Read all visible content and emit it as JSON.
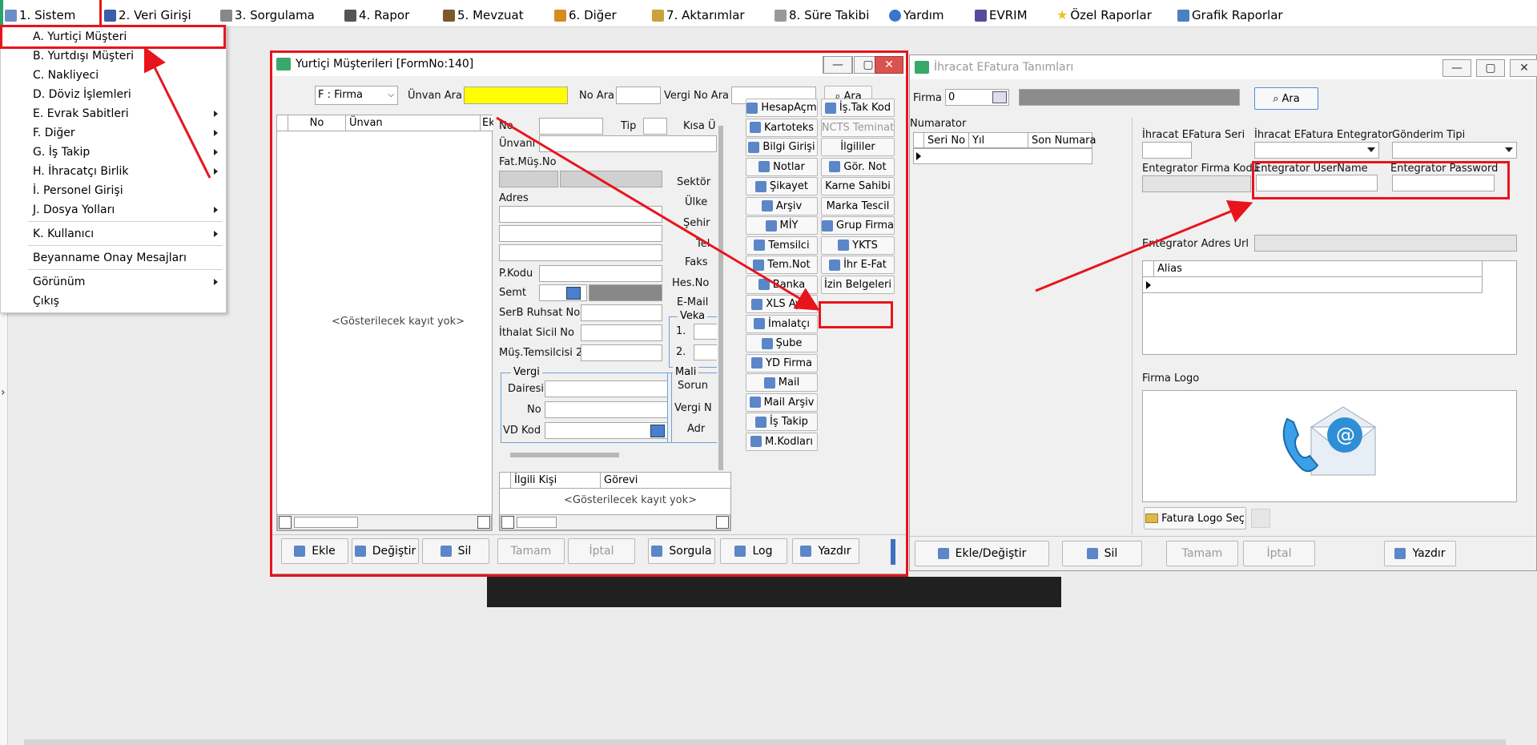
{
  "menu_bar": {
    "items": [
      {
        "label": "1.  Sistem",
        "icon": "system-icon"
      },
      {
        "label": "2.  Veri Girişi",
        "icon": "edit-icon"
      },
      {
        "label": "3.  Sorgulama",
        "icon": "query-icon"
      },
      {
        "label": "4.  Rapor",
        "icon": "printer-icon"
      },
      {
        "label": "5.  Mevzuat",
        "icon": "books-icon"
      },
      {
        "label": "6.  Diğer",
        "icon": "globe-icon"
      },
      {
        "label": "7.  Aktarımlar",
        "icon": "transfer-icon"
      },
      {
        "label": "8. Süre Takibi",
        "icon": "calendar-icon"
      },
      {
        "label": "Yardım",
        "icon": "help-icon"
      },
      {
        "label": "EVRIM",
        "icon": "book-icon"
      },
      {
        "label": "Özel Raporlar",
        "icon": "star-icon"
      },
      {
        "label": "Grafik Raporlar",
        "icon": "chart-icon"
      }
    ]
  },
  "sistem_menu": {
    "items": [
      {
        "label": "A.  Yurtiçi Müşteri",
        "has_submenu": false
      },
      {
        "label": "B.  Yurtdışı Müşteri",
        "has_submenu": false
      },
      {
        "label": "C.  Nakliyeci",
        "has_submenu": false
      },
      {
        "label": "D.  Döviz İşlemleri",
        "has_submenu": false
      },
      {
        "label": "E.  Evrak Sabitleri",
        "has_submenu": true
      },
      {
        "label": "F.  Diğer",
        "has_submenu": true
      },
      {
        "label": "G.  İş Takip",
        "has_submenu": true
      },
      {
        "label": "H.  İhracatçı Birlik",
        "has_submenu": true
      },
      {
        "label": "İ.   Personel Girişi",
        "has_submenu": false
      },
      {
        "label": "J.  Dosya Yolları",
        "has_submenu": true
      },
      {
        "label": "K.  Kullanıcı",
        "has_submenu": true
      },
      {
        "label": "Beyanname Onay Mesajları",
        "has_submenu": false
      },
      {
        "label": "Görünüm",
        "has_submenu": true
      },
      {
        "label": "Çıkış",
        "has_submenu": false
      }
    ]
  },
  "customer_window": {
    "title": "Yurtiçi Müşterileri [FormNo:140]",
    "firm_type": "F : Firma",
    "unvan_ara": "Ünvan Ara",
    "no_ara": "No Ara",
    "vergi_no_ara": "Vergi No Ara",
    "ara": "Ara",
    "list_cols": [
      "No",
      "Ünvan",
      "Ek"
    ],
    "no_records": "<Gösterilecek kayıt yok>",
    "labels": {
      "no": "No",
      "tip": "Tip",
      "kisa": "Kısa Ü",
      "unvani": "Ünvanı",
      "fat_mus_no": "Fat.Müş.No",
      "adres": "Adres",
      "pkodu": "P.Kodu",
      "semt": "Semt",
      "serb": "SerB Ruhsat No",
      "ithalat": "İthalat Sicil No",
      "mus_tem": "Müş.Temsilcisi 2",
      "vergi": "Vergi",
      "dairesi": "Dairesi",
      "vno": "No",
      "vd_kod": "VD Kod",
      "sektor": "Sektör",
      "ulke": "Ülke",
      "sehir": "Şehir",
      "tel": "Tel",
      "faks": "Faks",
      "hes_no": "Hes.No",
      "email": "E-Mail",
      "veka": "Veka",
      "v1": "1.",
      "v2": "2.",
      "mali": "Mali",
      "sorun": "Sorun",
      "vergi_n": "Vergi N",
      "adr": "Adr"
    },
    "contact_cols": [
      "İlgili Kişi",
      "Görevi"
    ],
    "side_buttons_left": [
      {
        "label": "HesapAçm",
        "icon": "account-icon"
      },
      {
        "label": "Kartoteks",
        "icon": "card-icon"
      },
      {
        "label": "Bilgi Girişi",
        "icon": "info-icon"
      },
      {
        "label": "Notlar",
        "icon": "notes-icon"
      },
      {
        "label": "Şikayet",
        "icon": "complaint-icon"
      },
      {
        "label": "Arşiv",
        "icon": "archive-icon"
      },
      {
        "label": "MİY",
        "icon": "miy-icon"
      },
      {
        "label": "Temsilci",
        "icon": "rep-icon"
      },
      {
        "label": "Tem.Not",
        "icon": "rep-note-icon"
      },
      {
        "label": "Banka",
        "icon": "bank-icon"
      },
      {
        "label": "XLS Ayar",
        "icon": "xls-icon"
      },
      {
        "label": "İmalatçı",
        "icon": "factory-icon"
      },
      {
        "label": "Şube",
        "icon": "branch-icon"
      },
      {
        "label": "YD Firma",
        "icon": "foreign-firm-icon"
      },
      {
        "label": "Mail",
        "icon": "mail-icon"
      },
      {
        "label": "Mail Arşiv",
        "icon": "mail-archive-icon"
      },
      {
        "label": "İş Takip",
        "icon": "tracking-icon"
      },
      {
        "label": "M.Kodları",
        "icon": "codes-icon"
      }
    ],
    "side_buttons_right": [
      {
        "label": "İş.Tak Kod",
        "icon": "track-code-icon",
        "disabled": false
      },
      {
        "label": "NCTS Teminat",
        "icon": "",
        "disabled": true
      },
      {
        "label": "İlgililer",
        "icon": "",
        "disabled": false
      },
      {
        "label": "Gör. Not",
        "icon": "note-view-icon",
        "disabled": false
      },
      {
        "label": "Karne Sahibi",
        "icon": "",
        "disabled": false
      },
      {
        "label": "Marka Tescil",
        "icon": "",
        "disabled": false
      },
      {
        "label": "Grup Firma",
        "icon": "group-icon",
        "disabled": false
      },
      {
        "label": "YKTS",
        "icon": "check-icon",
        "disabled": false
      },
      {
        "label": "İhr E-Fat",
        "icon": "efatura-icon",
        "disabled": false
      },
      {
        "label": "İzin Belgeleri",
        "icon": "",
        "disabled": false
      }
    ],
    "bottom_buttons": [
      {
        "label": "Ekle",
        "icon": "add-doc-icon",
        "disabled": false
      },
      {
        "label": "Değiştir",
        "icon": "edit-icon",
        "disabled": false
      },
      {
        "label": "Sil",
        "icon": "delete-icon",
        "disabled": false
      },
      {
        "label": "Tamam",
        "icon": "",
        "disabled": true
      },
      {
        "label": "İptal",
        "icon": "",
        "disabled": true
      },
      {
        "label": "Sorgula",
        "icon": "query-icon",
        "disabled": false
      },
      {
        "label": "Log",
        "icon": "log-icon",
        "disabled": false
      },
      {
        "label": "Yazdır",
        "icon": "printer-icon",
        "disabled": false
      }
    ]
  },
  "efatura_window": {
    "title": "İhracat EFatura Tanımları",
    "firma_label": "Firma",
    "firma_value": "0",
    "ara": "Ara",
    "numarator": "Numarator",
    "num_cols": [
      "Seri No",
      "Yıl",
      "Son Numara"
    ],
    "labels": {
      "seri": "İhracat EFatura Seri",
      "entegrator": "İhracat EFatura Entegrator",
      "gonderim": "Gönderim Tipi",
      "firma_kodu": "Entegrator Firma Kodu",
      "username": "Entegrator UserName",
      "password": "Entegrator Password",
      "adres_url": "Entegrator Adres Url",
      "alias": "Alias",
      "logo": "Firma Logo"
    },
    "logo_select": "Fatura Logo Seç",
    "bottom_buttons": [
      {
        "label": "Ekle/Değiştir",
        "icon": "edit-icon",
        "disabled": false
      },
      {
        "label": "Sil",
        "icon": "delete-icon",
        "disabled": false
      },
      {
        "label": "Tamam",
        "icon": "",
        "disabled": true
      },
      {
        "label": "İptal",
        "icon": "",
        "disabled": true
      },
      {
        "label": "Yazdır",
        "icon": "printer-icon",
        "disabled": false
      }
    ]
  },
  "colors": {
    "highlight": "#ffff00",
    "annotation": "#e8141c",
    "accent": "#2f7bd6"
  }
}
